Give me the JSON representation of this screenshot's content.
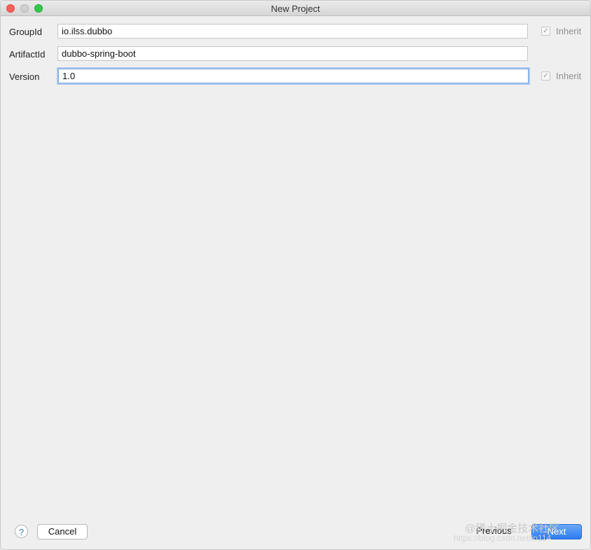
{
  "window": {
    "title": "New Project"
  },
  "form": {
    "rows": [
      {
        "label": "GroupId",
        "value": "io.ilss.dubbo",
        "inherit": "Inherit"
      },
      {
        "label": "ArtifactId",
        "value": "dubbo-spring-boot"
      },
      {
        "label": "Version",
        "value": "1.0",
        "inherit": "Inherit"
      }
    ]
  },
  "footer": {
    "help": "?",
    "cancel": "Cancel",
    "previous": "Previous",
    "next": "Next"
  },
  "watermark": {
    "line1": "@稀土掘金技术社区",
    "line2": "https://blog.csdn.net/lo114"
  },
  "colors": {
    "accent": "#2f7cf0",
    "focus": "#a9c8ef"
  }
}
